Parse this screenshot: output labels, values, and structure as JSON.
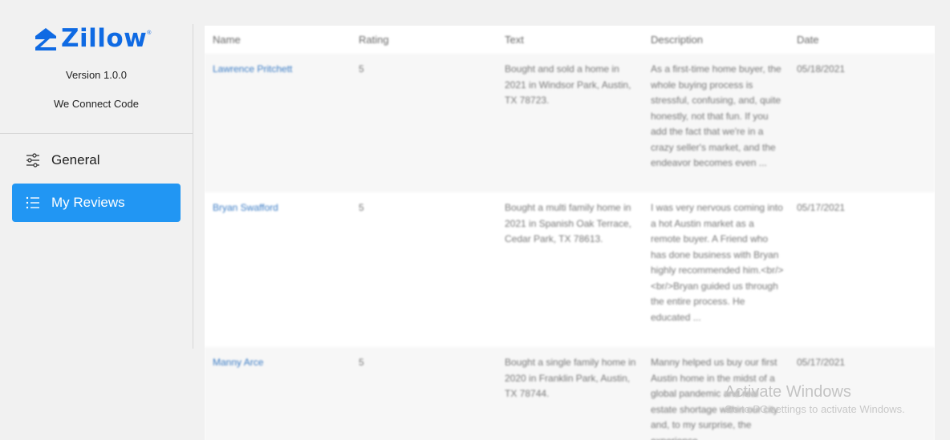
{
  "sidebar": {
    "logo_text": "Zillow",
    "logo_mark": "®",
    "version": "Version 1.0.0",
    "company": "We Connect Code",
    "nav": [
      {
        "label": "General",
        "icon": "sliders-icon",
        "active": false
      },
      {
        "label": "My Reviews",
        "icon": "list-icon",
        "active": true
      }
    ]
  },
  "table": {
    "headers": [
      "Name",
      "Rating",
      "Text",
      "Description",
      "Date"
    ],
    "rows": [
      {
        "name": "Lawrence Pritchett",
        "rating": "5",
        "text": "Bought and sold a home in 2021 in Windsor Park, Austin, TX 78723.",
        "description": "As a first-time home buyer, the whole buying process is stressful, confusing, and, quite honestly, not that fun. If you add the fact that we're in a crazy seller's market, and the endeavor becomes even ...",
        "date": "05/18/2021"
      },
      {
        "name": "Bryan Swafford",
        "rating": "5",
        "text": "Bought a multi family home in 2021 in Spanish Oak Terrace, Cedar Park, TX 78613.",
        "description": "I was very nervous coming into a hot Austin market as a remote buyer. A Friend who has done business with Bryan highly recommended him.<br/><br/>Bryan guided us through the entire process. He educated ...",
        "date": "05/17/2021"
      },
      {
        "name": "Manny Arce",
        "rating": "5",
        "text": "Bought a single family home in 2020 in Franklin Park, Austin, TX 78744.",
        "description": "Manny helped us buy our first Austin home in the midst of a global pandemic and real estate shortage within our city and, to my surprise, the experience ...",
        "date": "05/17/2021"
      }
    ]
  },
  "watermark": {
    "title": "Activate Windows",
    "subtitle": "Go to PC settings to activate Windows."
  },
  "colors": {
    "accent": "#2196f3",
    "brand": "#0f6ae3",
    "link": "#3a7bc4"
  }
}
